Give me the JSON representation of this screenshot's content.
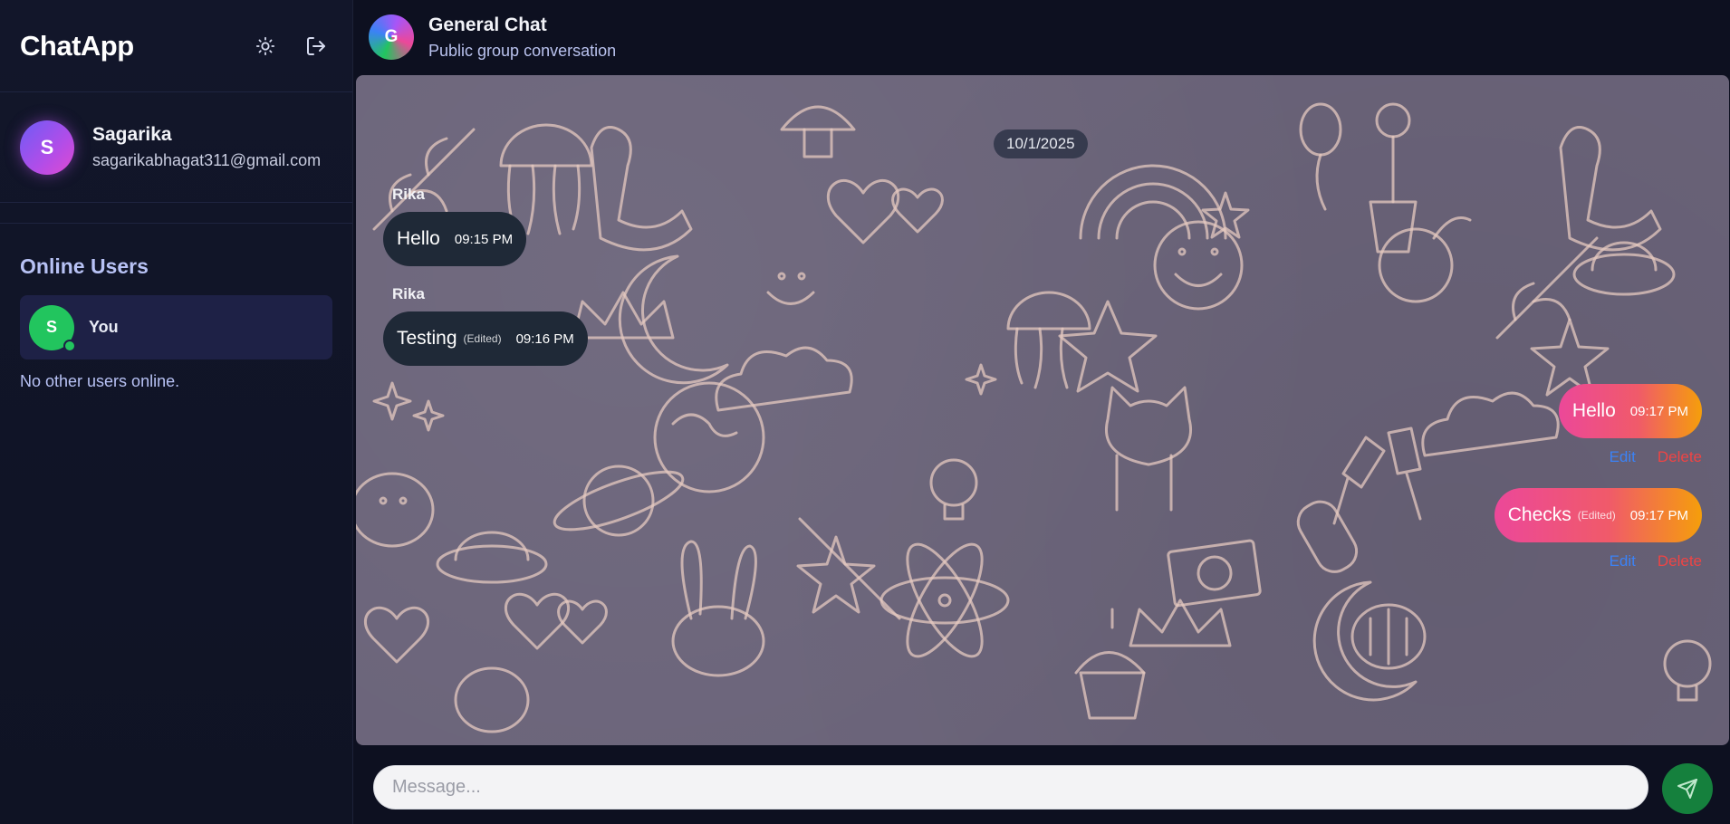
{
  "app": {
    "title": "ChatApp",
    "theme_toggle_icon": "sun-icon",
    "logout_icon": "logout-icon"
  },
  "profile": {
    "initial": "S",
    "name": "Sagarika",
    "email": "sagarikabhagat311@gmail.com"
  },
  "online": {
    "title": "Online Users",
    "users": [
      {
        "initial": "S",
        "name": "You",
        "status": "online"
      }
    ],
    "empty_text": "No other users online."
  },
  "chat": {
    "avatar_initial": "G",
    "title": "General Chat",
    "subtitle": "Public group conversation",
    "date": "10/1/2025",
    "messages": [
      {
        "sender": "Rika",
        "text": "Hello",
        "edited": "",
        "time": "09:15 PM",
        "own": false
      },
      {
        "sender": "Rika",
        "text": "Testing",
        "edited": "(Edited)",
        "time": "09:16 PM",
        "own": false
      },
      {
        "sender": "",
        "text": "Hello",
        "edited": "",
        "time": "09:17 PM",
        "own": true,
        "edit_label": "Edit",
        "delete_label": "Delete"
      },
      {
        "sender": "",
        "text": "Checks",
        "edited": "(Edited)",
        "time": "09:17 PM",
        "own": true,
        "edit_label": "Edit",
        "delete_label": "Delete"
      }
    ]
  },
  "composer": {
    "placeholder": "Message...",
    "value": "",
    "send_icon": "send-icon"
  },
  "colors": {
    "sidebar_bg": "#12162a",
    "online_green": "#22c55e",
    "send_button": "#15803d",
    "edit_link": "#3b82f6",
    "delete_link": "#ef4444",
    "incoming_bubble": "#1f2937",
    "outgoing_gradient_start": "#ec4899",
    "outgoing_gradient_end": "#f59e0b"
  }
}
